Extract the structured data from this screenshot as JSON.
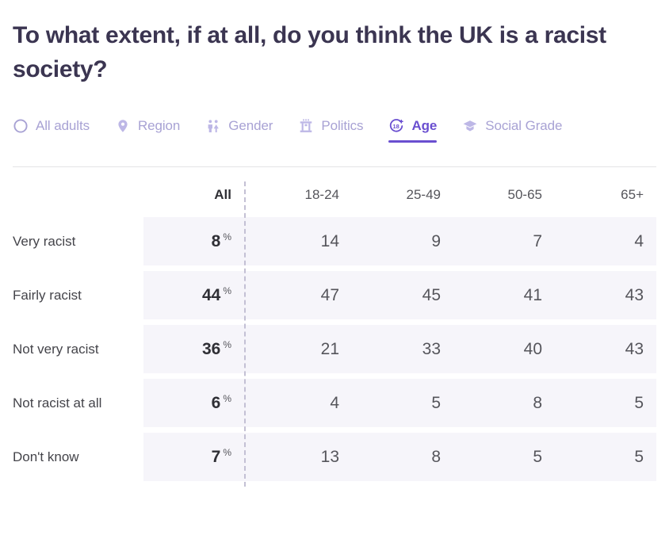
{
  "header": {
    "title": "To what extent, if at all, do you think the UK is a racist society?"
  },
  "tabs": [
    {
      "label": "All adults",
      "icon": "circle-icon",
      "active": false
    },
    {
      "label": "Region",
      "icon": "map-pin-icon",
      "active": false
    },
    {
      "label": "Gender",
      "icon": "gender-people-icon",
      "active": false
    },
    {
      "label": "Politics",
      "icon": "ballot-box-icon",
      "active": false
    },
    {
      "label": "Age",
      "icon": "age-18-plus-icon",
      "active": true
    },
    {
      "label": "Social Grade",
      "icon": "graduation-cap-icon",
      "active": false
    }
  ],
  "table": {
    "row_header_label": "",
    "all_column_header": "All",
    "percent_symbol": "%",
    "group_headers": [
      "18-24",
      "25-49",
      "50-65",
      "65+"
    ],
    "rows": [
      {
        "label": "Very racist",
        "all": "8",
        "values": [
          "14",
          "9",
          "7",
          "4"
        ]
      },
      {
        "label": "Fairly racist",
        "all": "44",
        "values": [
          "47",
          "45",
          "41",
          "43"
        ]
      },
      {
        "label": "Not very racist",
        "all": "36",
        "values": [
          "21",
          "33",
          "40",
          "43"
        ]
      },
      {
        "label": "Not racist at all",
        "all": "6",
        "values": [
          "4",
          "5",
          "8",
          "5"
        ]
      },
      {
        "label": "Don't know",
        "all": "7",
        "values": [
          "13",
          "8",
          "5",
          "5"
        ]
      }
    ]
  },
  "colors": {
    "accent": "#6a4fd0",
    "tab_inactive": "#a8a2d4",
    "title": "#3b3551",
    "cell_bg": "#f6f5fa",
    "divider": "#c3c0d4",
    "rule": "#e3e3e6"
  },
  "chart_data": {
    "type": "table",
    "title": "To what extent, if at all, do you think the UK is a racist society?",
    "breakdown": "Age",
    "unit": "%",
    "categories": [
      "Very racist",
      "Fairly racist",
      "Not very racist",
      "Not racist at all",
      "Don't know"
    ],
    "series": [
      {
        "name": "All",
        "values": [
          8,
          44,
          36,
          6,
          7
        ]
      },
      {
        "name": "18-24",
        "values": [
          14,
          47,
          21,
          4,
          13
        ]
      },
      {
        "name": "25-49",
        "values": [
          9,
          45,
          33,
          5,
          8
        ]
      },
      {
        "name": "50-65",
        "values": [
          7,
          41,
          40,
          8,
          5
        ]
      },
      {
        "name": "65+",
        "values": [
          4,
          43,
          43,
          5,
          5
        ]
      }
    ],
    "xlabel": "",
    "ylabel": "",
    "legend": [
      "All",
      "18-24",
      "25-49",
      "50-65",
      "65+"
    ]
  }
}
